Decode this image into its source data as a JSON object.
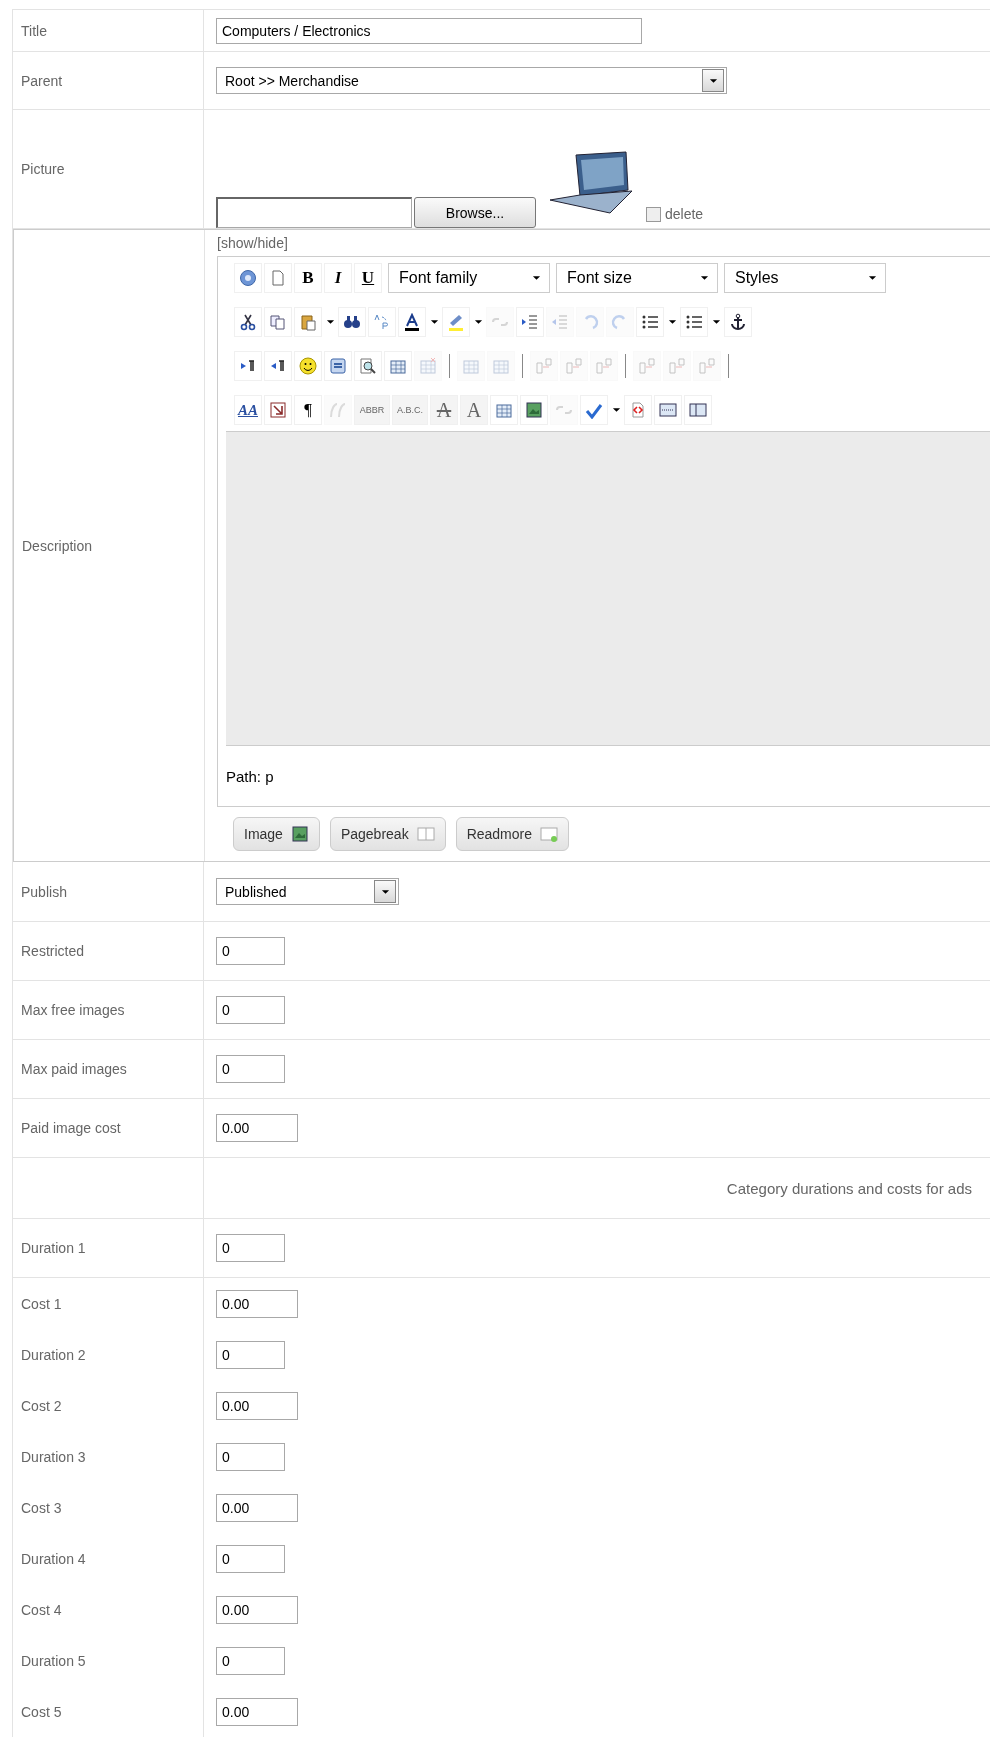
{
  "rows": [
    {
      "kind": "text",
      "label": "Title",
      "value": "Computers / Electronics"
    },
    {
      "kind": "select",
      "label": "Parent",
      "value": "Root >> Merchandise"
    },
    {
      "kind": "picture",
      "label": "Picture",
      "button": "Browse...",
      "delete_label": "delete",
      "delete_checked": false
    },
    {
      "kind": "editor",
      "label": "Description"
    },
    {
      "kind": "short-select",
      "label": "Publish",
      "value": "Published"
    },
    {
      "kind": "small",
      "label": "Restricted",
      "value": "0"
    },
    {
      "kind": "small",
      "label": "Max free images",
      "value": "0"
    },
    {
      "kind": "small",
      "label": "Max paid images",
      "value": "0"
    },
    {
      "kind": "small",
      "label": "Paid image cost",
      "value": "0.00"
    },
    {
      "kind": "heading",
      "text": "Category durations and costs for ads"
    },
    {
      "kind": "small",
      "label": "Duration 1",
      "value": "0"
    },
    {
      "kind": "price",
      "label": "Cost 1",
      "value": "0.00"
    },
    {
      "kind": "price",
      "label": "Duration 2",
      "value": "0"
    },
    {
      "kind": "price",
      "label": "Cost 2",
      "value": "0.00"
    },
    {
      "kind": "price",
      "label": "Duration 3",
      "value": "0"
    },
    {
      "kind": "price",
      "label": "Cost 3",
      "value": "0.00"
    },
    {
      "kind": "price",
      "label": "Duration 4",
      "value": "0"
    },
    {
      "kind": "price",
      "label": "Cost 4",
      "value": "0.00"
    },
    {
      "kind": "price",
      "label": "Duration 5",
      "value": "0"
    },
    {
      "kind": "price",
      "label": "Cost 5",
      "value": "0.00"
    }
  ],
  "editor": {
    "toggle": "[show/hide]",
    "path": "Path: p",
    "toolbar": [
      [
        {
          "kind": "help",
          "disabled": false
        },
        {
          "kind": "new-document",
          "disabled": false
        },
        {
          "kind": "bold",
          "label": "B",
          "disabled": false
        },
        {
          "kind": "italic",
          "label": "I",
          "disabled": false
        },
        {
          "kind": "underline",
          "label": "U",
          "disabled": false
        },
        {
          "kind": "select",
          "label": "Font family",
          "disabled": false
        },
        {
          "kind": "select",
          "label": "Font size",
          "disabled": false
        },
        {
          "kind": "select",
          "label": "Styles",
          "disabled": false
        }
      ],
      [
        {
          "kind": "cut",
          "disabled": false
        },
        {
          "kind": "copy",
          "disabled": false
        },
        {
          "kind": "paste",
          "disabled": false
        },
        {
          "kind": "dropdown",
          "disabled": false
        },
        {
          "kind": "find",
          "disabled": false
        },
        {
          "kind": "replace",
          "disabled": false
        },
        {
          "kind": "text-color",
          "disabled": false
        },
        {
          "kind": "dropdown",
          "disabled": false
        },
        {
          "kind": "highlight",
          "disabled": false
        },
        {
          "kind": "dropdown",
          "disabled": false
        },
        {
          "kind": "unlink",
          "disabled": true
        },
        {
          "kind": "indent",
          "disabled": false
        },
        {
          "kind": "outdent",
          "disabled": true
        },
        {
          "kind": "undo",
          "disabled": true
        },
        {
          "kind": "redo",
          "disabled": true
        },
        {
          "kind": "numbered-list",
          "disabled": false
        },
        {
          "kind": "dropdown",
          "disabled": false
        },
        {
          "kind": "bullet-list",
          "disabled": false
        },
        {
          "kind": "dropdown",
          "disabled": false
        },
        {
          "kind": "anchor",
          "disabled": false
        }
      ],
      [
        {
          "kind": "ltr",
          "disabled": false
        },
        {
          "kind": "rtl",
          "disabled": false
        },
        {
          "kind": "smiley",
          "disabled": false
        },
        {
          "kind": "media",
          "disabled": false
        },
        {
          "kind": "preview",
          "disabled": false
        },
        {
          "kind": "table",
          "disabled": false
        },
        {
          "kind": "delete-table",
          "disabled": true
        },
        {
          "kind": "separator"
        },
        {
          "kind": "row-properties",
          "disabled": true
        },
        {
          "kind": "cell-properties",
          "disabled": true
        },
        {
          "kind": "separator"
        },
        {
          "kind": "row-before",
          "disabled": true
        },
        {
          "kind": "row-after",
          "disabled": true
        },
        {
          "kind": "delete-row",
          "disabled": true
        },
        {
          "kind": "separator"
        },
        {
          "kind": "column-before",
          "disabled": true
        },
        {
          "kind": "column-after",
          "disabled": true
        },
        {
          "kind": "delete-column",
          "disabled": true
        },
        {
          "kind": "separator"
        }
      ],
      [
        {
          "kind": "style",
          "label": "AA",
          "disabled": false
        },
        {
          "kind": "paste-text",
          "disabled": false
        },
        {
          "kind": "pilcrow",
          "label": "¶",
          "disabled": false
        },
        {
          "kind": "cite",
          "disabled": true
        },
        {
          "kind": "small-text",
          "label": "ABBR",
          "disabled": true
        },
        {
          "kind": "small-text",
          "label": "A.B.C.",
          "disabled": true
        },
        {
          "kind": "strikethrough",
          "label": "A",
          "disabled": true
        },
        {
          "kind": "plain-a",
          "label": "A",
          "disabled": true
        },
        {
          "kind": "template",
          "disabled": false
        },
        {
          "kind": "image",
          "disabled": false
        },
        {
          "kind": "link",
          "disabled": true
        },
        {
          "kind": "spellcheck",
          "disabled": false
        },
        {
          "kind": "dropdown",
          "disabled": false
        },
        {
          "kind": "code",
          "disabled": false
        },
        {
          "kind": "horizontal-rule",
          "disabled": false
        },
        {
          "kind": "layer",
          "disabled": false
        }
      ]
    ],
    "buttons": [
      {
        "label": "Image",
        "kind": "image"
      },
      {
        "label": "Pagebreak",
        "kind": "pagebreak"
      },
      {
        "label": "Readmore",
        "kind": "readmore"
      }
    ]
  }
}
